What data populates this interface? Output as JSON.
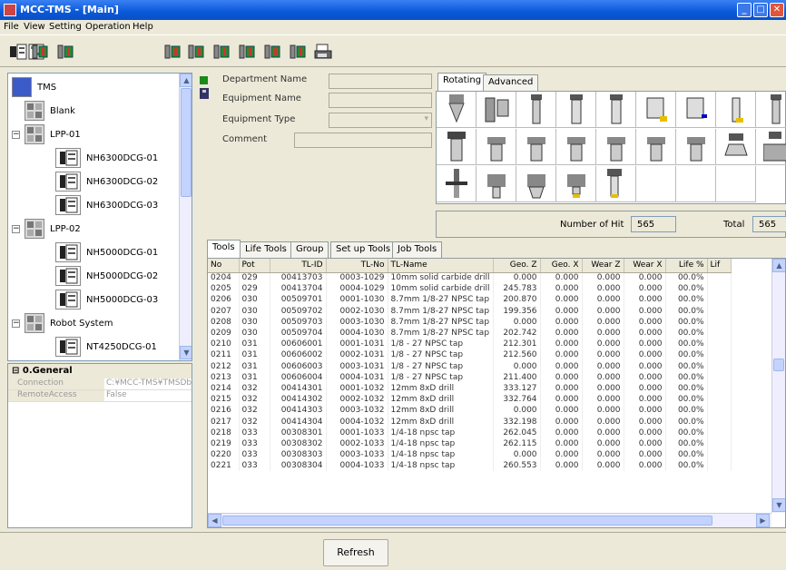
{
  "window": {
    "title": "MCC-TMS - [Main]",
    "buttons": [
      "_",
      "□",
      "✕"
    ]
  },
  "menu": [
    "File",
    "View",
    "Setting",
    "Operation",
    "Help"
  ],
  "toolbar": {
    "icons": [
      "module-icon",
      "tree-edit-icon",
      "tool-add-icon",
      "tool-move-icon",
      "tool-copy-icon",
      "tool-swap-icon",
      "tool-measure-icon",
      "tool-transfer-icon",
      "tool-link-icon",
      "print-icon"
    ]
  },
  "tree": {
    "nodes": [
      {
        "label": "TMS",
        "level": 0
      },
      {
        "label": "Blank",
        "level": 1
      },
      {
        "label": "LPP-01",
        "level": 1,
        "expanded": true
      },
      {
        "label": "NH6300DCG-01",
        "level": 2
      },
      {
        "label": "NH6300DCG-02",
        "level": 2
      },
      {
        "label": "NH6300DCG-03",
        "level": 2
      },
      {
        "label": "LPP-02",
        "level": 1,
        "expanded": true
      },
      {
        "label": "NH5000DCG-01",
        "level": 2
      },
      {
        "label": "NH5000DCG-02",
        "level": 2
      },
      {
        "label": "NH5000DCG-03",
        "level": 2
      },
      {
        "label": "Robot System",
        "level": 1,
        "expanded": true
      },
      {
        "label": "NT4250DCG-01",
        "level": 2
      }
    ]
  },
  "properties": {
    "header": "0.General",
    "rows": [
      {
        "key": "Connection",
        "value": "C:¥MCC-TMS¥TMSDb"
      },
      {
        "key": "RemoteAccess",
        "value": "False"
      }
    ]
  },
  "info": {
    "department_label": "Department Name",
    "equipment_label": "Equipment Name",
    "type_label": "Equipment Type",
    "comment_label": "Comment"
  },
  "tool_tabs": [
    "Rotating",
    "Advanced"
  ],
  "hits": {
    "number_label": "Number of Hit",
    "number_value": "565",
    "total_label": "Total",
    "total_value": "565"
  },
  "grid_tabs": [
    "Tools",
    "Life Tools",
    "Group",
    "Set up Tools",
    "Job Tools"
  ],
  "grid": {
    "columns": [
      "No",
      "Pot",
      "TL-ID",
      "TL-No",
      "TL-Name",
      "Geo. Z",
      "Geo. X",
      "Wear Z",
      "Wear X",
      "Life %",
      "Lif"
    ],
    "rows": [
      [
        "0204",
        "029",
        "00413703",
        "0003-1029",
        "10mm solid carbide drill",
        "0.000",
        "0.000",
        "0.000",
        "0.000",
        "00.0%",
        ""
      ],
      [
        "0205",
        "029",
        "00413704",
        "0004-1029",
        "10mm solid carbide drill",
        "245.783",
        "0.000",
        "0.000",
        "0.000",
        "00.0%",
        ""
      ],
      [
        "0206",
        "030",
        "00509701",
        "0001-1030",
        "8.7mm 1/8-27 NPSC tap",
        "200.870",
        "0.000",
        "0.000",
        "0.000",
        "00.0%",
        ""
      ],
      [
        "0207",
        "030",
        "00509702",
        "0002-1030",
        "8.7mm 1/8-27 NPSC tap",
        "199.356",
        "0.000",
        "0.000",
        "0.000",
        "00.0%",
        ""
      ],
      [
        "0208",
        "030",
        "00509703",
        "0003-1030",
        "8.7mm 1/8-27 NPSC tap",
        "0.000",
        "0.000",
        "0.000",
        "0.000",
        "00.0%",
        ""
      ],
      [
        "0209",
        "030",
        "00509704",
        "0004-1030",
        "8.7mm 1/8-27 NPSC tap",
        "202.742",
        "0.000",
        "0.000",
        "0.000",
        "00.0%",
        ""
      ],
      [
        "0210",
        "031",
        "00606001",
        "0001-1031",
        "1/8 - 27 NPSC tap",
        "212.301",
        "0.000",
        "0.000",
        "0.000",
        "00.0%",
        ""
      ],
      [
        "0211",
        "031",
        "00606002",
        "0002-1031",
        "1/8 - 27 NPSC tap",
        "212.560",
        "0.000",
        "0.000",
        "0.000",
        "00.0%",
        ""
      ],
      [
        "0212",
        "031",
        "00606003",
        "0003-1031",
        "1/8 - 27 NPSC tap",
        "0.000",
        "0.000",
        "0.000",
        "0.000",
        "00.0%",
        ""
      ],
      [
        "0213",
        "031",
        "00606004",
        "0004-1031",
        "1/8 - 27 NPSC tap",
        "211.400",
        "0.000",
        "0.000",
        "0.000",
        "00.0%",
        ""
      ],
      [
        "0214",
        "032",
        "00414301",
        "0001-1032",
        "12mm 8xD drill",
        "333.127",
        "0.000",
        "0.000",
        "0.000",
        "00.0%",
        ""
      ],
      [
        "0215",
        "032",
        "00414302",
        "0002-1032",
        "12mm 8xD drill",
        "332.764",
        "0.000",
        "0.000",
        "0.000",
        "00.0%",
        ""
      ],
      [
        "0216",
        "032",
        "00414303",
        "0003-1032",
        "12mm 8xD drill",
        "0.000",
        "0.000",
        "0.000",
        "0.000",
        "00.0%",
        ""
      ],
      [
        "0217",
        "032",
        "00414304",
        "0004-1032",
        "12mm 8xD drill",
        "332.198",
        "0.000",
        "0.000",
        "0.000",
        "00.0%",
        ""
      ],
      [
        "0218",
        "033",
        "00308301",
        "0001-1033",
        "1/4-18 npsc tap",
        "262.045",
        "0.000",
        "0.000",
        "0.000",
        "00.0%",
        ""
      ],
      [
        "0219",
        "033",
        "00308302",
        "0002-1033",
        "1/4-18 npsc tap",
        "262.115",
        "0.000",
        "0.000",
        "0.000",
        "00.0%",
        ""
      ],
      [
        "0220",
        "033",
        "00308303",
        "0003-1033",
        "1/4-18 npsc tap",
        "0.000",
        "0.000",
        "0.000",
        "0.000",
        "00.0%",
        ""
      ],
      [
        "0221",
        "033",
        "00308304",
        "0004-1033",
        "1/4-18 npsc tap",
        "260.553",
        "0.000",
        "0.000",
        "0.000",
        "00.0%",
        ""
      ]
    ]
  },
  "refresh_label": "Refresh"
}
